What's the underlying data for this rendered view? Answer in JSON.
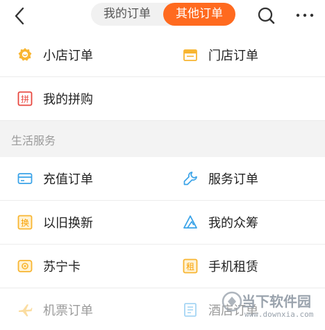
{
  "header": {
    "tabs": [
      {
        "label": "我的订单",
        "active": false
      },
      {
        "label": "其他订单",
        "active": true
      }
    ],
    "accent_color": "#ff6a1f"
  },
  "groups": [
    {
      "left": {
        "label": "小店订单",
        "icon": "shop-icon"
      },
      "right": {
        "label": "门店订单",
        "icon": "store-icon"
      }
    },
    {
      "left": {
        "label": "我的拼购",
        "icon": "group-buy-icon"
      }
    }
  ],
  "section": {
    "title": "生活服务"
  },
  "services": [
    {
      "left": {
        "label": "充值订单",
        "icon": "recharge-card-icon"
      },
      "right": {
        "label": "服务订单",
        "icon": "wrench-icon"
      }
    },
    {
      "left": {
        "label": "以旧换新",
        "icon": "trade-in-icon"
      },
      "right": {
        "label": "我的众筹",
        "icon": "crowdfunding-icon"
      }
    },
    {
      "left": {
        "label": "苏宁卡",
        "icon": "suning-card-icon"
      },
      "right": {
        "label": "手机租赁",
        "icon": "rental-icon"
      }
    },
    {
      "left": {
        "label": "机票订单",
        "icon": "plane-icon"
      },
      "right": {
        "label": "酒店订单",
        "icon": "hotel-icon"
      }
    }
  ],
  "watermark": {
    "text": "当下软件园",
    "url": "www.downxia.com"
  }
}
